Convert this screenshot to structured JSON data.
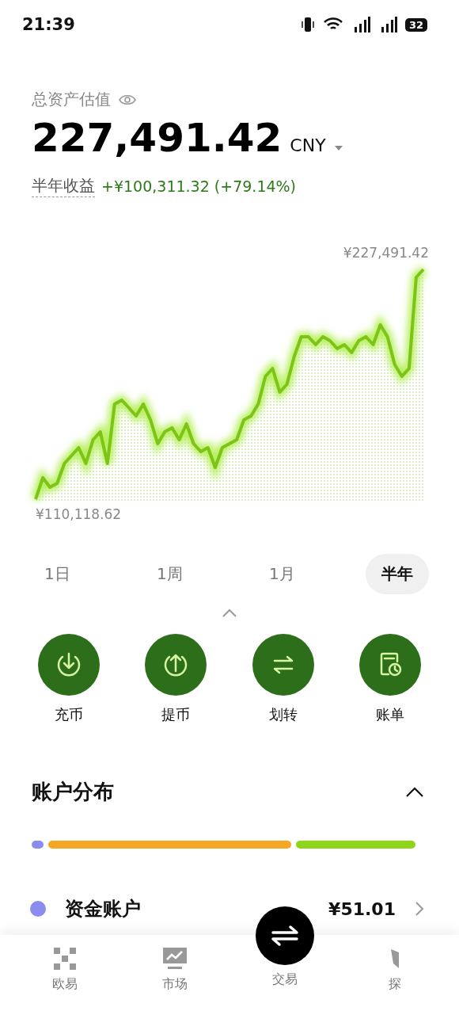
{
  "status_bar": {
    "time": "21:39",
    "battery": "32"
  },
  "summary": {
    "label": "总资产估值",
    "amount": "227,491.42",
    "currency": "CNY",
    "pnl_label": "半年收益",
    "pnl_value": "+¥100,311.32 (+79.14%)"
  },
  "chart": {
    "max_label": "¥227,491.42",
    "min_label": "¥110,118.62"
  },
  "periods": [
    {
      "label": "1日",
      "selected": false
    },
    {
      "label": "1周",
      "selected": false
    },
    {
      "label": "1月",
      "selected": false
    },
    {
      "label": "半年",
      "selected": true
    }
  ],
  "actions": [
    {
      "kind": "deposit",
      "label": "充币"
    },
    {
      "kind": "withdraw",
      "label": "提币"
    },
    {
      "kind": "transfer",
      "label": "划转"
    },
    {
      "kind": "bill",
      "label": "账单"
    }
  ],
  "distribution": {
    "title": "账户分布",
    "expanded": true,
    "segments": [
      {
        "color": "#8a8cf0"
      },
      {
        "color": "#f5a623"
      },
      {
        "color": "#8fd61a"
      }
    ],
    "accounts": [
      {
        "name": "资金账户",
        "value": "¥51.01",
        "color": "#8a8cf0"
      }
    ]
  },
  "bottom_nav": [
    {
      "kind": "home",
      "label": "欧易"
    },
    {
      "kind": "market",
      "label": "市场"
    },
    {
      "kind": "trade",
      "label": "交易"
    },
    {
      "kind": "explore",
      "label": "探"
    }
  ]
}
